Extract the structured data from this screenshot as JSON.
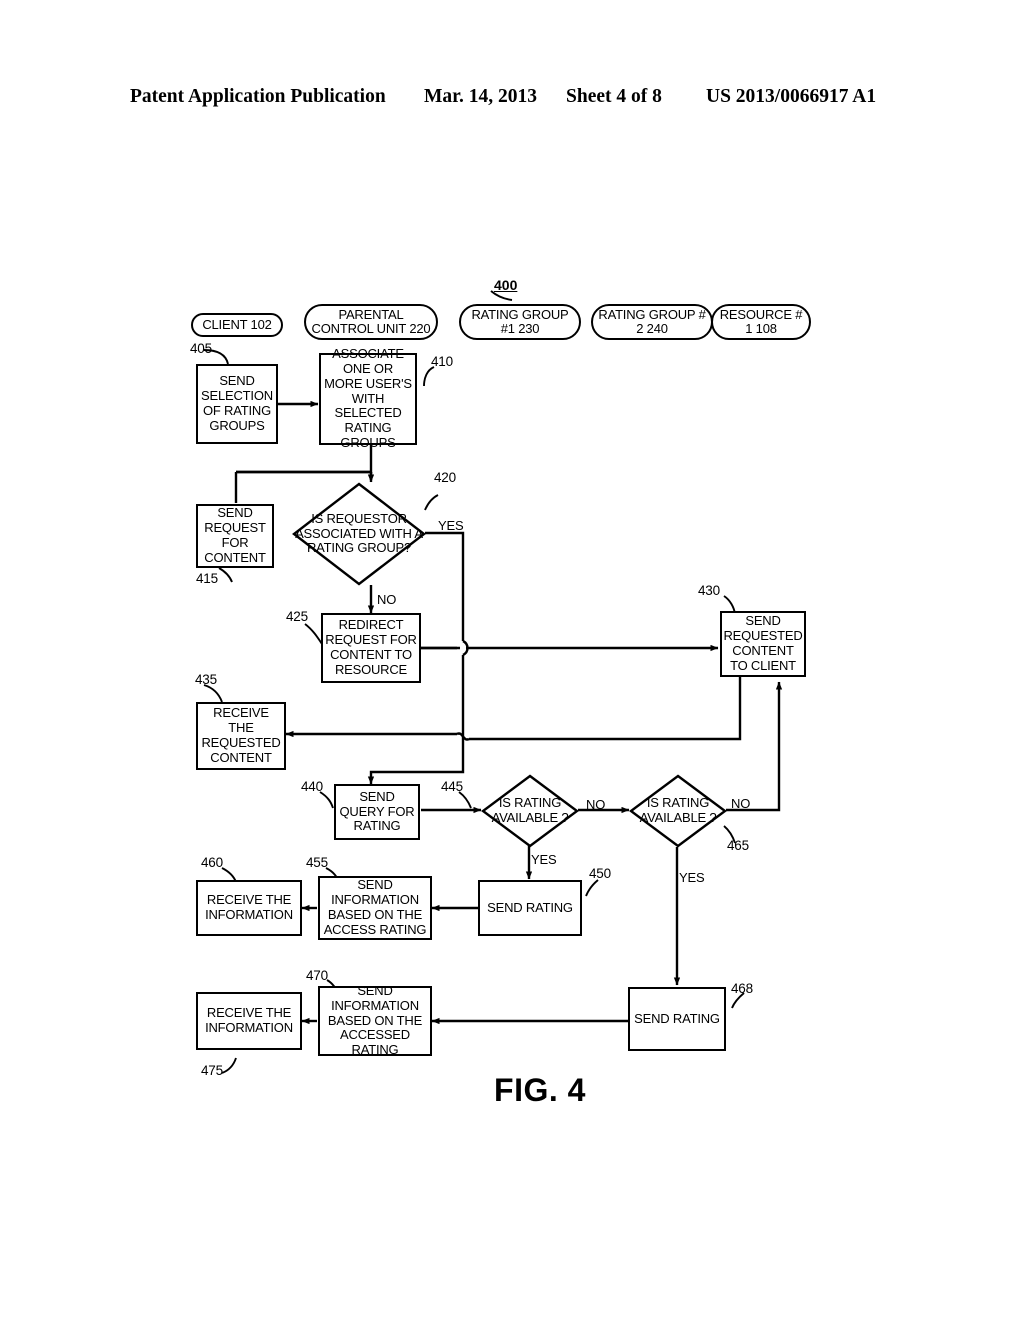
{
  "header": {
    "publication": "Patent Application Publication",
    "date": "Mar. 14, 2013",
    "sheet": "Sheet 4 of 8",
    "number": "US 2013/0066917 A1"
  },
  "figure": {
    "caption": "FIG. 4",
    "diagram_ref": "400",
    "lanes": [
      {
        "id": "client",
        "label": "CLIENT 102"
      },
      {
        "id": "parental-control",
        "label": "PARENTAL CONTROL UNIT 220"
      },
      {
        "id": "rating-group-1",
        "label": "RATING GROUP #1 230"
      },
      {
        "id": "rating-group-2",
        "label": "RATING GROUP # 2 240"
      },
      {
        "id": "resource-1",
        "label": "RESOURCE # 1 108"
      }
    ],
    "nodes": [
      {
        "ref": "405",
        "type": "process",
        "label": "SEND SELECTION OF RATING GROUPS"
      },
      {
        "ref": "410",
        "type": "process",
        "label": "ASSOCIATE ONE OR MORE USER'S WITH SELECTED RATING GROUPS"
      },
      {
        "ref": "415",
        "type": "process",
        "label": "SEND REQUEST FOR CONTENT"
      },
      {
        "ref": "420",
        "type": "decision",
        "label": "IS REQUESTOR ASSOCIATED WITH A RATING GROUP?"
      },
      {
        "ref": "425",
        "type": "process",
        "label": "REDIRECT REQUEST FOR CONTENT TO RESOURCE"
      },
      {
        "ref": "430",
        "type": "process",
        "label": "SEND REQUESTED CONTENT TO CLIENT"
      },
      {
        "ref": "435",
        "type": "process",
        "label": "RECEIVE THE REQUESTED CONTENT"
      },
      {
        "ref": "440",
        "type": "process",
        "label": "SEND QUERY FOR RATING"
      },
      {
        "ref": "445",
        "type": "decision",
        "label": "IS RATING AVAILABLE ?"
      },
      {
        "ref": "450",
        "type": "process",
        "label": "SEND RATING"
      },
      {
        "ref": "455",
        "type": "process",
        "label": "SEND INFORMATION BASED ON THE ACCESS RATING"
      },
      {
        "ref": "460",
        "type": "process",
        "label": "RECEIVE THE INFORMATION"
      },
      {
        "ref": "465",
        "type": "decision",
        "label": "IS RATING AVAILABLE ?"
      },
      {
        "ref": "468",
        "type": "process",
        "label": "SEND RATING"
      },
      {
        "ref": "470",
        "type": "process",
        "label": "SEND INFORMATION BASED ON THE ACCESSED RATING"
      },
      {
        "ref": "475",
        "type": "process",
        "label": "RECEIVE THE INFORMATION"
      }
    ],
    "edge_labels": {
      "d420_yes": "YES",
      "d420_no": "NO",
      "d445_yes": "YES",
      "d445_no": "NO",
      "d465_yes": "YES",
      "d465_no": "NO"
    }
  }
}
